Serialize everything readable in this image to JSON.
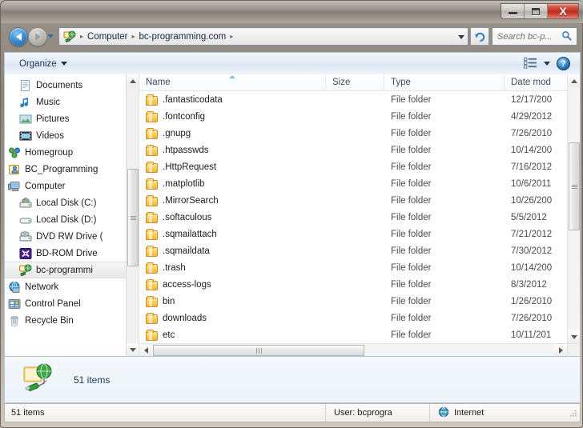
{
  "window": {
    "buttons": {
      "minimize": "–",
      "maximize": "□",
      "close": "X"
    }
  },
  "navigation": {
    "back_label": "Back",
    "forward_label": "Forward",
    "history_label": "Recent pages",
    "refresh_label": "Refresh",
    "breadcrumbs": [
      "Computer",
      "bc-programming.com"
    ],
    "separator": "▸"
  },
  "search": {
    "placeholder": "Search bc-p...",
    "value": "",
    "icon": "search-icon"
  },
  "toolbar": {
    "organize_label": "Organize",
    "view_icon": "view-list-icon",
    "view_dropdown_icon": "chevron-down-icon",
    "help_label": "?"
  },
  "sidebar": {
    "items": [
      {
        "label": "Documents",
        "icon": "document-icon",
        "indent": 1,
        "selected": false
      },
      {
        "label": "Music",
        "icon": "music-note-icon",
        "indent": 1,
        "selected": false
      },
      {
        "label": "Pictures",
        "icon": "picture-icon",
        "indent": 1,
        "selected": false
      },
      {
        "label": "Videos",
        "icon": "video-icon",
        "indent": 1,
        "selected": false
      },
      {
        "label": "Homegroup",
        "icon": "homegroup-icon",
        "indent": 0,
        "selected": false
      },
      {
        "label": "BC_Programming",
        "icon": "user-folder-icon",
        "indent": 0,
        "selected": false
      },
      {
        "label": "Computer",
        "icon": "computer-icon",
        "indent": 0,
        "selected": false
      },
      {
        "label": "Local Disk (C:)",
        "icon": "system-drive-icon",
        "indent": 1,
        "selected": false
      },
      {
        "label": "Local Disk (D:)",
        "icon": "drive-icon",
        "indent": 1,
        "selected": false
      },
      {
        "label": "DVD RW Drive (",
        "icon": "dvd-drive-icon",
        "indent": 1,
        "selected": false
      },
      {
        "label": "BD-ROM Drive",
        "icon": "bluray-drive-icon",
        "indent": 1,
        "selected": false
      },
      {
        "label": "bc-programmi",
        "icon": "ftp-site-icon",
        "indent": 1,
        "selected": true
      },
      {
        "label": "Network",
        "icon": "network-icon",
        "indent": 0,
        "selected": false
      },
      {
        "label": "Control Panel",
        "icon": "control-panel-icon",
        "indent": 0,
        "selected": false
      },
      {
        "label": "Recycle Bin",
        "icon": "recycle-bin-icon",
        "indent": 0,
        "selected": false
      }
    ]
  },
  "filelist": {
    "columns": [
      {
        "label": "Name",
        "sorted": true
      },
      {
        "label": "Size",
        "sorted": false
      },
      {
        "label": "Type",
        "sorted": false
      },
      {
        "label": "Date mod",
        "sorted": false
      }
    ],
    "rows": [
      {
        "name": ".fantasticodata",
        "size": "",
        "type": "File folder",
        "date": "12/17/200"
      },
      {
        "name": ".fontconfig",
        "size": "",
        "type": "File folder",
        "date": "4/29/2012"
      },
      {
        "name": ".gnupg",
        "size": "",
        "type": "File folder",
        "date": "7/26/2010"
      },
      {
        "name": ".htpasswds",
        "size": "",
        "type": "File folder",
        "date": "10/14/200"
      },
      {
        "name": ".HttpRequest",
        "size": "",
        "type": "File folder",
        "date": "7/16/2012"
      },
      {
        "name": ".matplotlib",
        "size": "",
        "type": "File folder",
        "date": "10/6/2011"
      },
      {
        "name": ".MirrorSearch",
        "size": "",
        "type": "File folder",
        "date": "10/26/200"
      },
      {
        "name": ".softaculous",
        "size": "",
        "type": "File folder",
        "date": "5/5/2012"
      },
      {
        "name": ".sqmailattach",
        "size": "",
        "type": "File folder",
        "date": "7/21/2012"
      },
      {
        "name": ".sqmaildata",
        "size": "",
        "type": "File folder",
        "date": "7/30/2012"
      },
      {
        "name": ".trash",
        "size": "",
        "type": "File folder",
        "date": "10/14/200"
      },
      {
        "name": "access-logs",
        "size": "",
        "type": "File folder",
        "date": "8/3/2012"
      },
      {
        "name": "bin",
        "size": "",
        "type": "File folder",
        "date": "1/26/2010"
      },
      {
        "name": "downloads",
        "size": "",
        "type": "File folder",
        "date": "7/26/2010"
      },
      {
        "name": "etc",
        "size": "",
        "type": "File folder",
        "date": "10/11/201"
      }
    ]
  },
  "details_pane": {
    "icon": "ftp-site-icon",
    "text": "51 items"
  },
  "statusbar": {
    "items_text": "51 items",
    "user_text": "User: bcprogra",
    "zone_text": "Internet",
    "zone_icon": "globe-icon"
  },
  "colors": {
    "accent": "#2f7fc4",
    "folder": "#f3b63c",
    "titlebar": "#8a837b",
    "close_button": "#b8301f",
    "selection": "#e9e9e9"
  }
}
